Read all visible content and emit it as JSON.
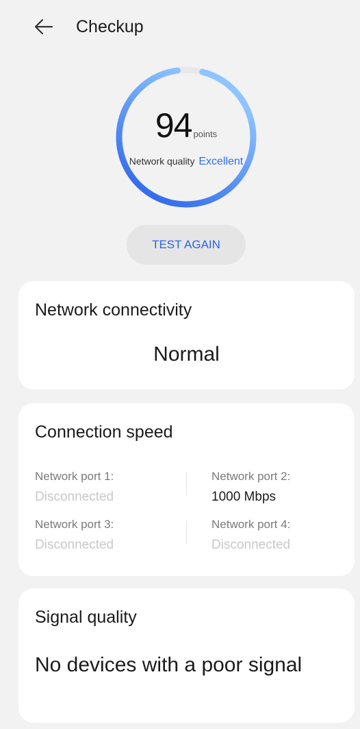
{
  "header": {
    "title": "Checkup",
    "back_icon": "arrow-left-icon"
  },
  "gauge": {
    "score": "94",
    "unit": "points",
    "quality_label": "Network quality",
    "quality_value": "Excellent",
    "score_fraction": 0.94,
    "colors": {
      "arc_start": "#2a63e8",
      "arc_end": "#8ec4ff",
      "track": "#e8e8e8"
    }
  },
  "test_button": {
    "label": "TEST AGAIN"
  },
  "connectivity": {
    "title": "Network connectivity",
    "value": "Normal"
  },
  "speed": {
    "title": "Connection speed",
    "ports": [
      {
        "label": "Network port 1:",
        "value": "Disconnected"
      },
      {
        "label": "Network port 2:",
        "value": "1000 Mbps"
      },
      {
        "label": "Network port 3:",
        "value": "Disconnected"
      },
      {
        "label": "Network port 4:",
        "value": "Disconnected"
      }
    ]
  },
  "signal": {
    "title": "Signal quality",
    "value": "No devices with a poor signal"
  }
}
